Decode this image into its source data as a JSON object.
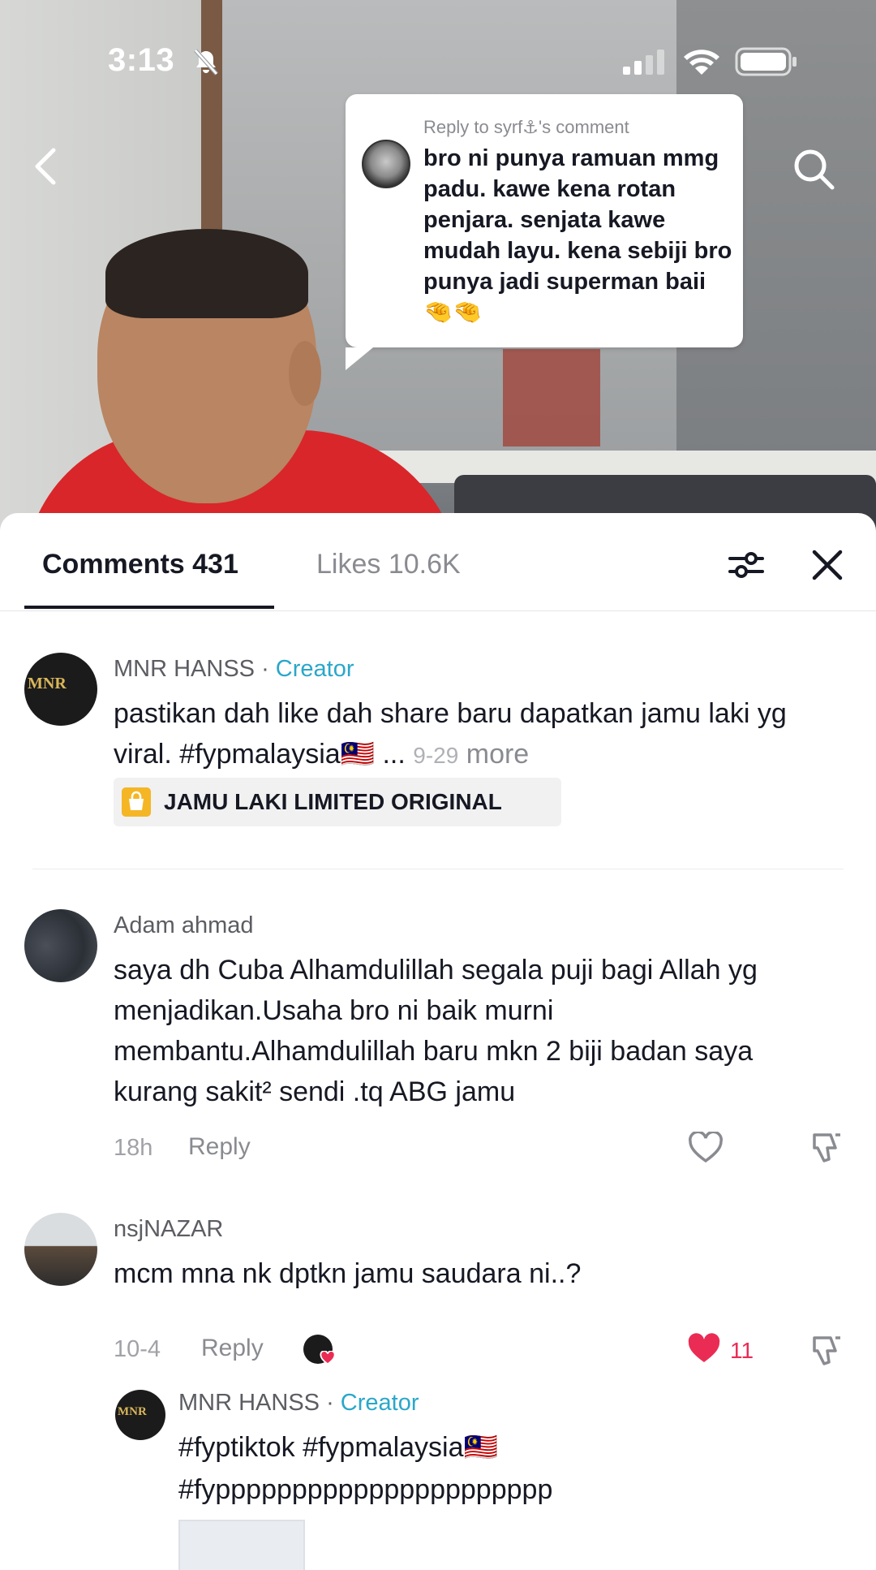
{
  "status_bar": {
    "time": "3:13"
  },
  "video": {
    "reply_bubble": {
      "header": "Reply to syrf⚓'s comment",
      "text": "bro ni punya ramuan mmg padu. kawe kena rotan penjara. senjata kawe mudah layu. kena sebiji bro punya jadi superman baii 🤏🤏"
    }
  },
  "sheet": {
    "tabs": {
      "comments": "Comments 431",
      "likes": "Likes 10.6K"
    },
    "comments": [
      {
        "username": "MNR HANSS",
        "badge": "Creator",
        "avatar_text": "MNR",
        "text": "pastikan dah like dah share baru dapatkan jamu laki yg viral. #fypmalaysia🇲🇾",
        "ellipsis": "...",
        "date": "9-29",
        "more": "more",
        "product": "JAMU LAKI LIMITED ORIGINAL"
      },
      {
        "username": "Adam ahmad",
        "text": "saya dh Cuba Alhamdulillah segala puji bagi Allah yg menjadikan.Usaha bro ni baik murni membantu.Alhamdulillah baru mkn 2 biji badan saya kurang sakit² sendi .tq ABG jamu",
        "date": "18h",
        "reply": "Reply"
      },
      {
        "username": "nsjNAZAR",
        "text": "mcm mna nk dptkn jamu saudara ni..?",
        "date": "10-4",
        "reply": "Reply",
        "likes": "11",
        "replies": [
          {
            "username": "MNR HANSS",
            "badge": "Creator",
            "avatar_text": "MNR",
            "line1": "#fyptiktok #fypmalaysia🇲🇾",
            "line2": "#fypppppppppppppppppppppp"
          }
        ]
      }
    ]
  },
  "colors": {
    "accent_like": "#ea2c54",
    "creator_badge": "#2aa7c9",
    "text": "#161823",
    "muted": "#8a8b91"
  },
  "icons": [
    "back-icon",
    "search-icon",
    "filter-icon",
    "close-icon",
    "heart-icon",
    "dislike-icon",
    "shopping-bag-icon"
  ]
}
